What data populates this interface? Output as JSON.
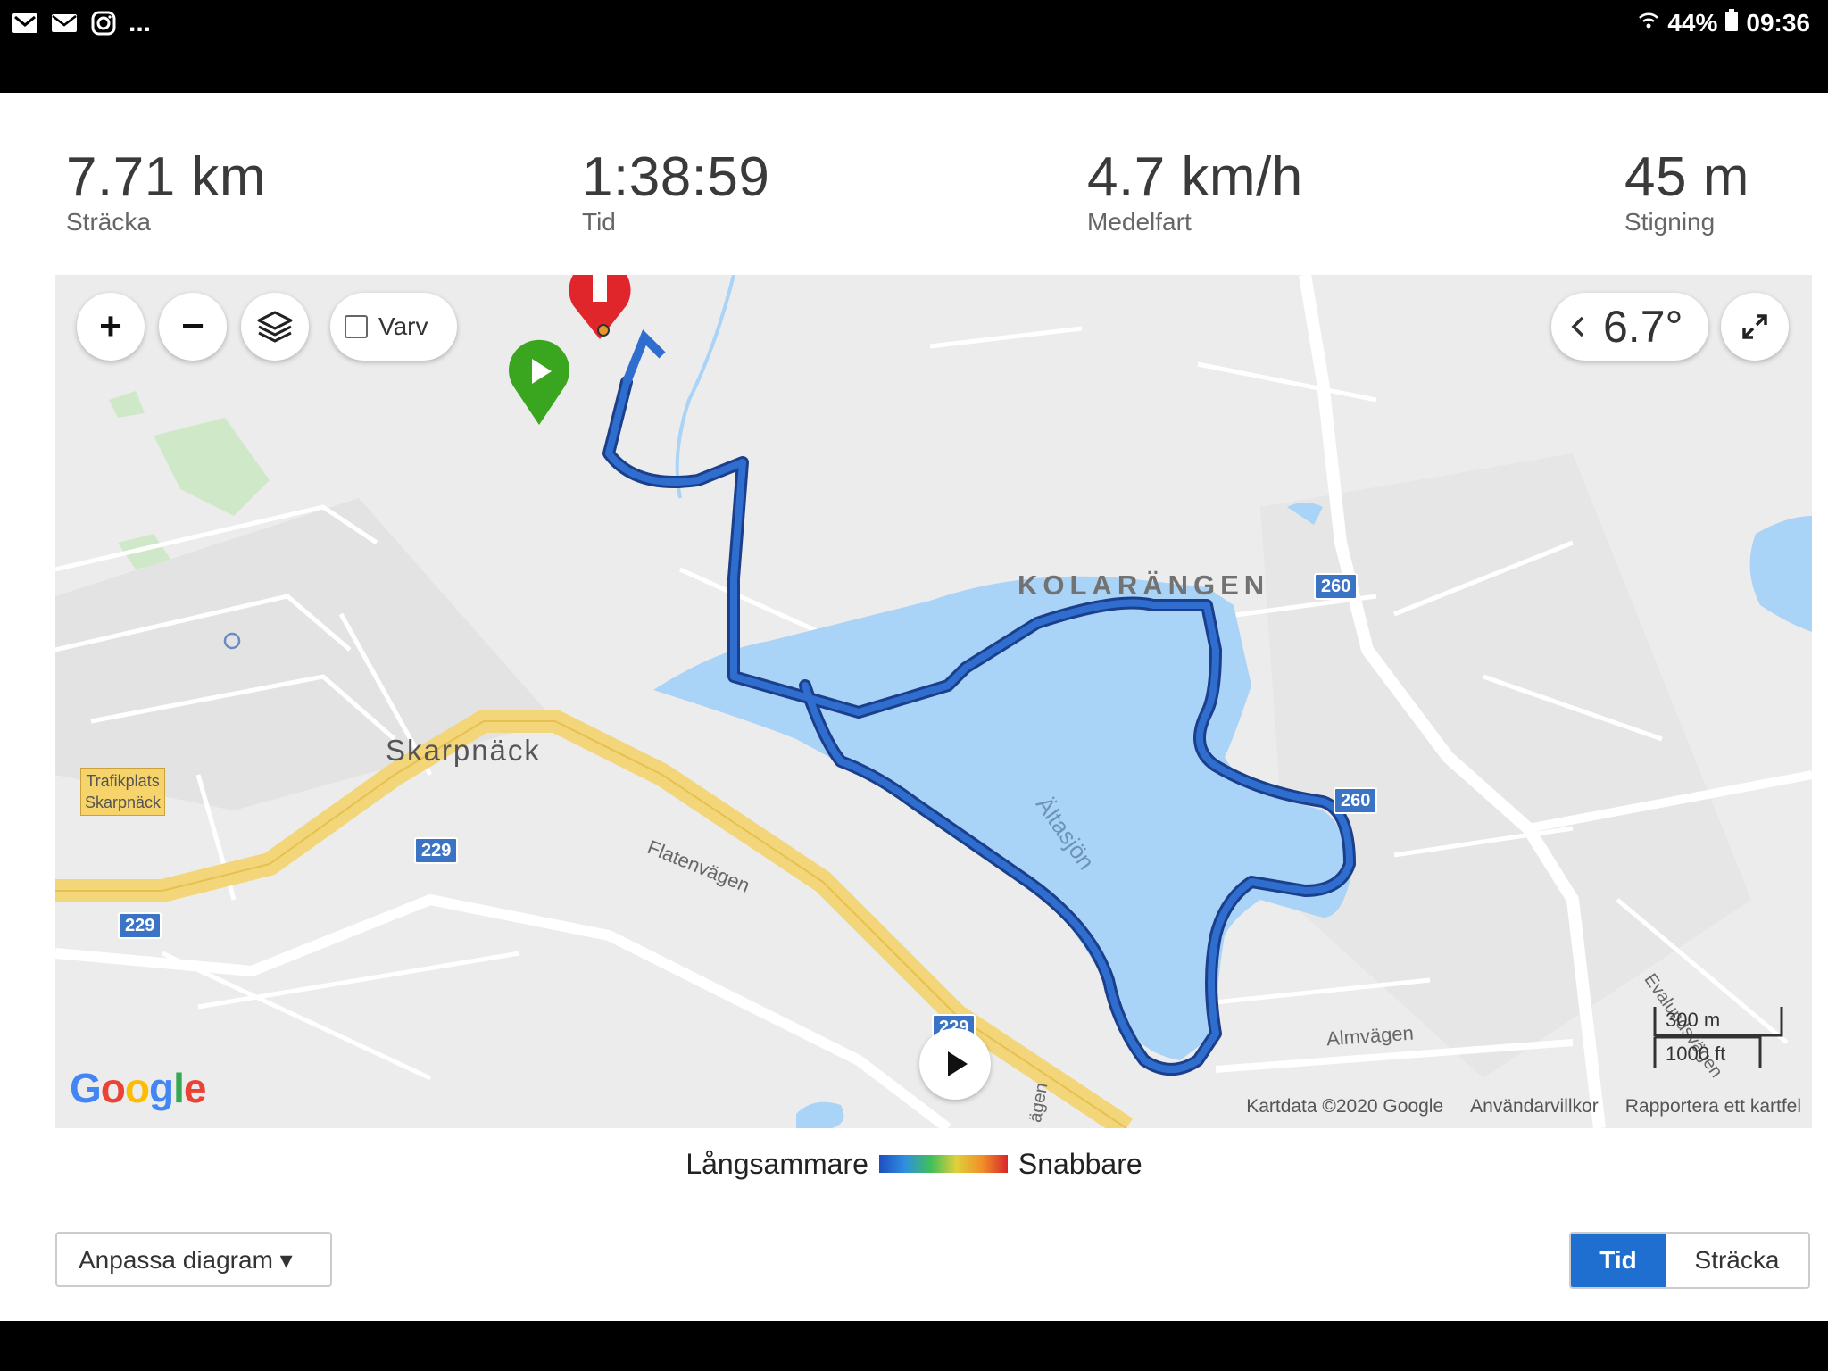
{
  "status_bar": {
    "left_icons": [
      "gmail-icon",
      "mail-icon",
      "instagram-icon"
    ],
    "more": "...",
    "battery": "44%",
    "time": "09:36"
  },
  "stats": [
    {
      "value": "7.71 km",
      "label": "Sträcka"
    },
    {
      "value": "1:38:59",
      "label": "Tid"
    },
    {
      "value": "4.7 km/h",
      "label": "Medelfart"
    },
    {
      "value": "45 m",
      "label": "Stigning"
    }
  ],
  "map": {
    "controls": {
      "zoom_in": "+",
      "zoom_out": "−",
      "laps_label": "Varv",
      "temperature": "6.7°"
    },
    "labels": {
      "kolarangen": "KOLARÄNGEN",
      "skarpnack": "Skarpnäck",
      "altasjon": "Ältasjön",
      "flatenvagen": "Flatenvägen",
      "almvagen": "Almvägen",
      "trafikplats": "Trafikplats",
      "trafikplats2": "Skarpnäck",
      "evalund": "Evalundsvägen",
      "partial_road": "ägen"
    },
    "shields": [
      "229",
      "229",
      "229",
      "260",
      "260"
    ],
    "scale": {
      "metric": "300 m",
      "imperial": "1000 ft"
    },
    "attribution": {
      "logo": "Google",
      "mapdata": "Kartdata ©2020 Google",
      "terms": "Användarvillkor",
      "report": "Rapportera ett kartfel"
    }
  },
  "legend": {
    "slower": "Långsammare",
    "faster": "Snabbare"
  },
  "customize_button": "Anpassa diagram ▾",
  "toggle": {
    "time": "Tid",
    "distance": "Sträcka",
    "selected": "Tid"
  },
  "colors": {
    "route": "#1f5fbf",
    "water": "#a9d3f7",
    "accent": "#1f6fd0",
    "start": "#3aa51e",
    "finish": "#e0252b"
  }
}
